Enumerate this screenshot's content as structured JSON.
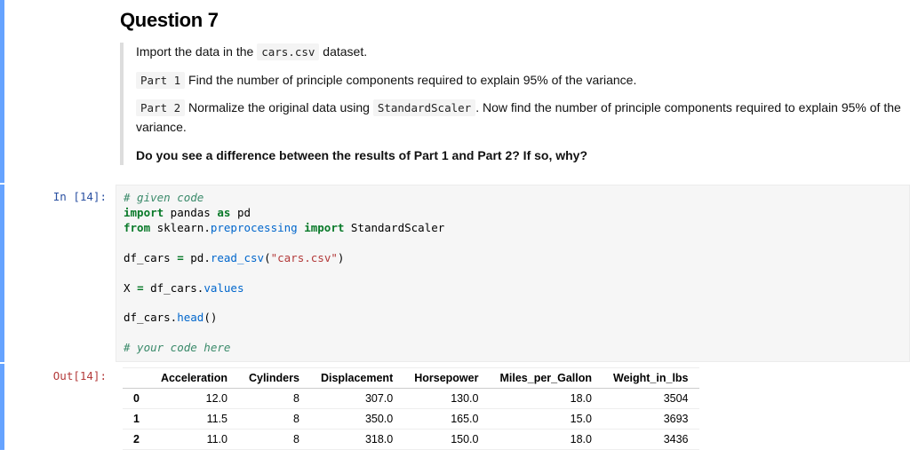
{
  "question": {
    "title": "Question 7",
    "intro_a": "Import the data in the ",
    "intro_code": "cars.csv",
    "intro_b": " dataset.",
    "part1_tag": "Part 1",
    "part1_text": " Find the number of principle components required to explain 95% of the variance.",
    "part2_tag": "Part 2",
    "part2_a": " Normalize the original data using ",
    "part2_code": "StandardScaler",
    "part2_b": ". Now find the number of principle components required to explain 95% of the variance.",
    "closing": "Do you see a difference between the results of Part 1 and Part 2? If so, why?"
  },
  "code": {
    "prompt_in": "In [14]:",
    "c01": "# given code",
    "c02a": "import",
    "c02b": " pandas ",
    "c02c": "as",
    "c02d": " pd",
    "c03a": "from",
    "c03b": " sklearn.",
    "c03c": "preprocessing",
    "c03d": " ",
    "c03e": "import",
    "c03f": " StandardScaler",
    "c04a": "df_cars ",
    "c04b": "=",
    "c04c": " pd.",
    "c04d": "read_csv",
    "c04e": "(",
    "c04f": "\"cars.csv\"",
    "c04g": ")",
    "c05a": "X ",
    "c05b": "=",
    "c05c": " df_cars.",
    "c05d": "values",
    "c06a": "df_cars.",
    "c06b": "head",
    "c06c": "()",
    "c07": "# your code here"
  },
  "output": {
    "prompt_out": "Out[14]:",
    "cols": [
      "Acceleration",
      "Cylinders",
      "Displacement",
      "Horsepower",
      "Miles_per_Gallon",
      "Weight_in_lbs"
    ],
    "idx": [
      "0",
      "1",
      "2"
    ],
    "rows": [
      [
        "12.0",
        "8",
        "307.0",
        "130.0",
        "18.0",
        "3504"
      ],
      [
        "11.5",
        "8",
        "350.0",
        "165.0",
        "15.0",
        "3693"
      ],
      [
        "11.0",
        "8",
        "318.0",
        "150.0",
        "18.0",
        "3436"
      ]
    ]
  }
}
